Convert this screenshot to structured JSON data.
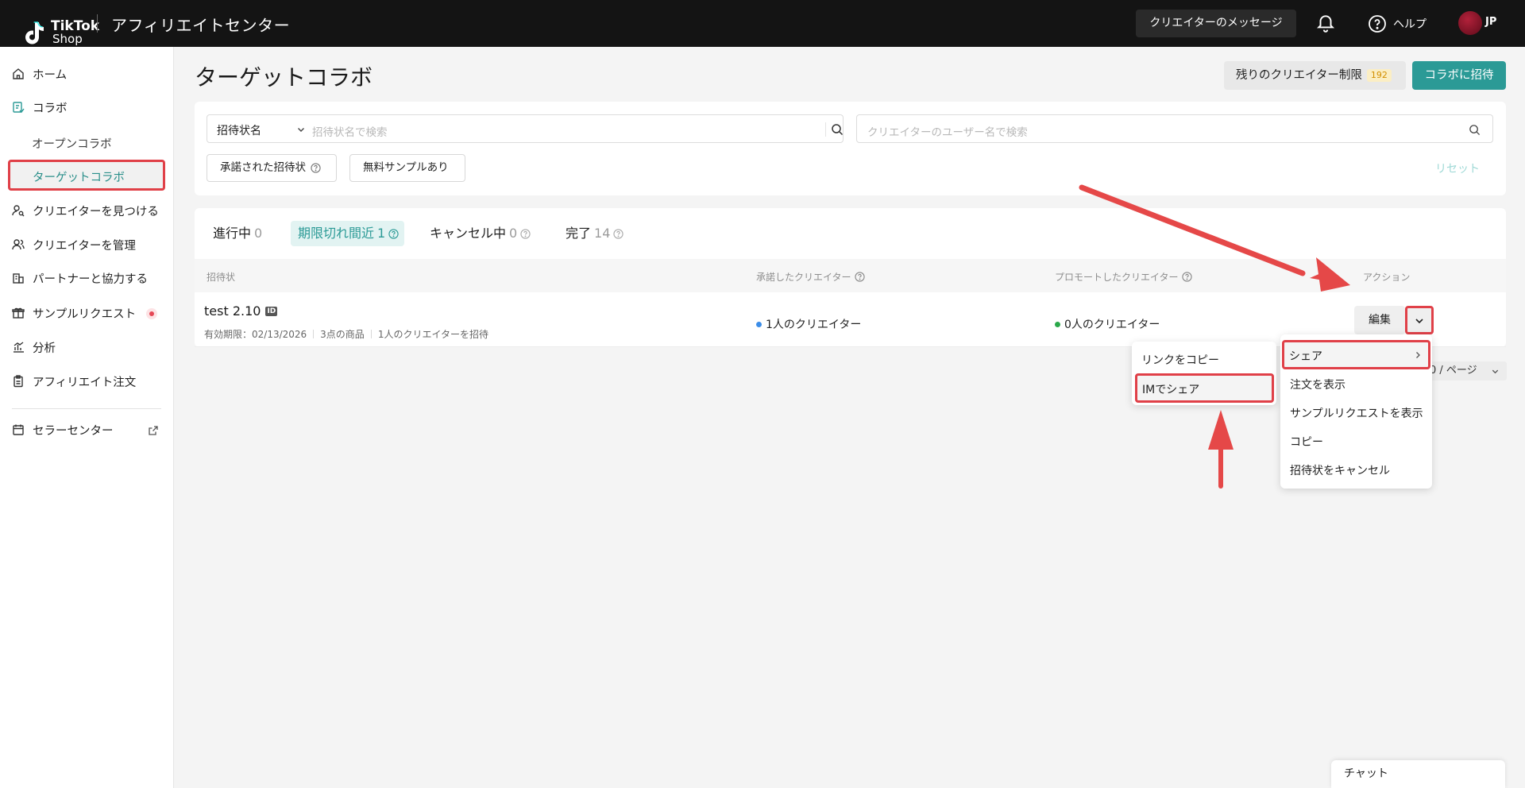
{
  "topbar": {
    "logo_line1": "TikTok",
    "logo_line2": "Shop",
    "app_title": "アフィリエイトセンター",
    "messages_button": "クリエイターのメッセージ",
    "help_label": "ヘルプ",
    "region": "JP"
  },
  "sidebar": {
    "home": "ホーム",
    "collab": "コラボ",
    "open_collab": "オープンコラボ",
    "target_collab": "ターゲットコラボ",
    "find_creators": "クリエイターを見つける",
    "manage_creators": "クリエイターを管理",
    "partners": "パートナーと協力する",
    "sample_requests": "サンプルリクエスト",
    "analytics": "分析",
    "affiliate_orders": "アフィリエイト注文",
    "seller_center": "セラーセンター"
  },
  "header": {
    "title": "ターゲットコラボ",
    "limit_label": "残りのクリエイター制限",
    "limit_count": "192",
    "invite_button": "コラボに招待"
  },
  "filters": {
    "select_value": "招待状名",
    "search_placeholder": "招待状名で検索",
    "creator_placeholder": "クリエイターのユーザー名で検索",
    "chip_accepted": "承諾された招待状",
    "chip_free_sample": "無料サンプルあり",
    "reset": "リセット"
  },
  "tabs": [
    {
      "label": "進行中",
      "count": "0"
    },
    {
      "label": "期限切れ間近",
      "count": "1"
    },
    {
      "label": "キャンセル中",
      "count": "0"
    },
    {
      "label": "完了",
      "count": "14"
    }
  ],
  "table": {
    "columns": {
      "invitation": "招待状",
      "accepted": "承諾したクリエイター",
      "promoted": "プロモートしたクリエイター",
      "actions": "アクション"
    },
    "row": {
      "name": "test 2.10",
      "id_badge": "ID",
      "expiry": "有効期限：02/13/2026",
      "products": "3点の商品",
      "invited": "1人のクリエイターを招待",
      "accepted": "1人のクリエイター",
      "promoted": "0人のクリエイター",
      "edit": "編集"
    }
  },
  "pager": {
    "label": "0 / ページ"
  },
  "share_submenu": {
    "copy_link": "リンクをコピー",
    "share_im": "IMでシェア"
  },
  "action_menu": {
    "share": "シェア",
    "view_orders": "注文を表示",
    "view_samples": "サンプルリクエストを表示",
    "copy": "コピー",
    "cancel_invitation": "招待状をキャンセル"
  },
  "chat": {
    "label": "チャット"
  },
  "colors": {
    "accent": "#2b9a96",
    "highlight": "#e04048",
    "accepted_dot": "#3b8de8",
    "promoted_dot": "#2aa84a"
  }
}
